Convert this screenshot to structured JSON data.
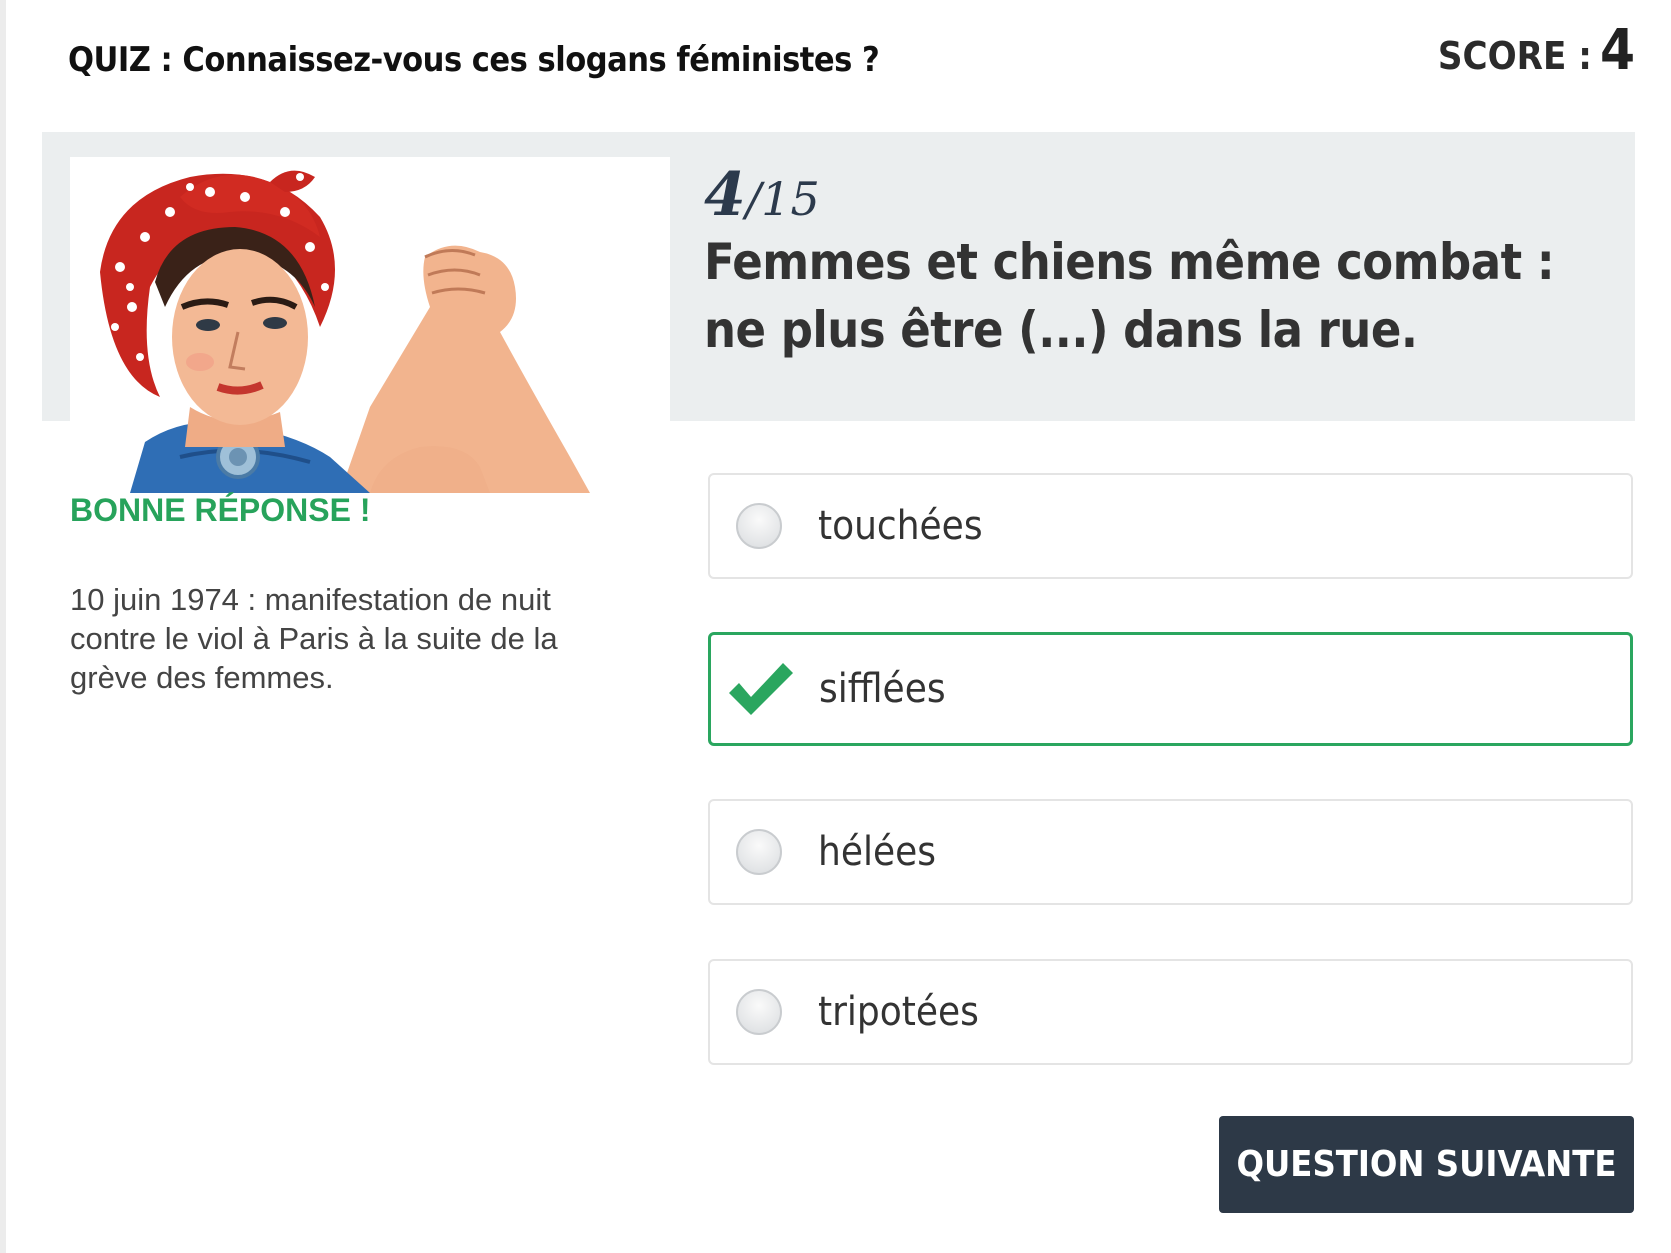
{
  "header": {
    "quiz_title": "QUIZ : Connaissez-vous ces slogans féministes ?",
    "score_label": "SCORE :",
    "score_value": "4"
  },
  "question": {
    "current": "4",
    "separator": "/",
    "total": "15",
    "text": "Femmes et chiens même combat : ne plus être (...) dans la rue.",
    "image_icon": "rosie-the-riveter-illustration"
  },
  "feedback": {
    "result": "BONNE RÉPONSE !",
    "explanation": "10 juin 1974 : manifestation de nuit contre le viol à Paris à la suite de la grève des femmes."
  },
  "answers": [
    {
      "label": "touchées",
      "state": "unselected",
      "icon": "radio-icon"
    },
    {
      "label": "sifflées",
      "state": "correct",
      "icon": "check-icon"
    },
    {
      "label": "hélées",
      "state": "unselected",
      "icon": "radio-icon"
    },
    {
      "label": "tripotées",
      "state": "unselected",
      "icon": "radio-icon"
    }
  ],
  "next_button": {
    "label": "QUESTION SUIVANTE"
  },
  "colors": {
    "correct": "#2aa65f",
    "button_bg": "#2d3947",
    "banner_bg": "#ebeeef",
    "counter": "#2c3a4c"
  }
}
